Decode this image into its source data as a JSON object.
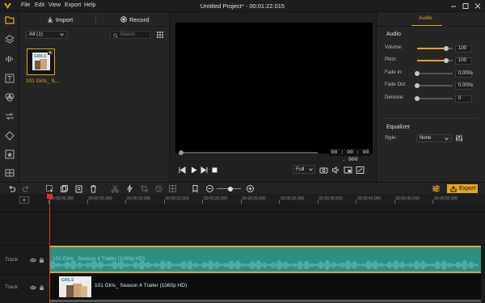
{
  "window": {
    "title": "Untitled Project* - 00:01:22.015",
    "menu": [
      "File",
      "Edit",
      "View",
      "Export",
      "Help"
    ]
  },
  "media": {
    "import_label": "Import",
    "record_label": "Record",
    "filter_value": "All (1)",
    "search_placeholder": "Search",
    "clip_caption": "101 Girls_ S..."
  },
  "preview": {
    "timecode": "00 : 00 : 00 . 000",
    "zoom": "Full"
  },
  "audio": {
    "tab": "Audio",
    "section": "Audio",
    "params": [
      {
        "label": "Volume:",
        "value": "100",
        "level": 0.82
      },
      {
        "label": "Pitch:",
        "value": "100",
        "level": 0.82
      },
      {
        "label": "Fade In:",
        "value": "0.000s",
        "level": 0.0
      },
      {
        "label": "Fade Out:",
        "value": "0.000s",
        "level": 0.0
      },
      {
        "label": "Denoise:",
        "value": "0",
        "level": 0.0
      }
    ],
    "equalizer": "Equalizer",
    "style_label": "Style:",
    "style_value": "None"
  },
  "toolbar": {
    "export_label": "Export"
  },
  "timeline": {
    "ticks": [
      "00:00:00.000",
      "00:00:05.000",
      "00:00:10.000",
      "00:00:15.000",
      "00:00:20.000",
      "00:00:25.000",
      "00:00:30.000",
      "00:00:35.000",
      "00:00:40.000",
      "00:00:45.000",
      "00:00:50.000"
    ],
    "track_label": "Track",
    "audio_clip_label": "101 Girls_ Season 4 Trailer (1080p HD)",
    "video_clip_label": "101 Girls_ Season 4 Trailer (1080p HD)",
    "thumb_text": "GIRLS"
  },
  "colors": {
    "accent": "#e6a31d",
    "audio_clip": "#2e8f86",
    "playhead": "#e03030"
  }
}
